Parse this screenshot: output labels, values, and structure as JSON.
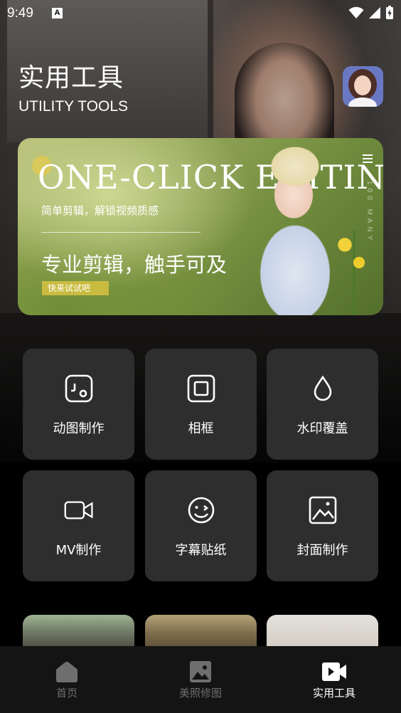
{
  "status_bar": {
    "time": "9:49",
    "notification_letter": "A"
  },
  "header": {
    "title": "实用工具",
    "subtitle": "UTILITY TOOLS"
  },
  "banner": {
    "headline": "ONE-CLICK EDITING",
    "subtitle": "简单剪辑，解锁视频质感",
    "slogan": "专业剪辑，触手可及",
    "cta": "快来试试吧",
    "vertical_text": "100 MANY"
  },
  "tools": [
    {
      "label": "动图制作",
      "icon": "gif-maker-icon"
    },
    {
      "label": "相框",
      "icon": "frame-icon"
    },
    {
      "label": "水印覆盖",
      "icon": "watermark-drop-icon"
    },
    {
      "label": "MV制作",
      "icon": "video-camera-icon"
    },
    {
      "label": "字幕贴纸",
      "icon": "wink-face-icon"
    },
    {
      "label": "封面制作",
      "icon": "image-icon"
    }
  ],
  "bottom_nav": {
    "items": [
      {
        "label": "首页",
        "icon": "home-icon",
        "active": false
      },
      {
        "label": "美照修图",
        "icon": "photo-icon",
        "active": false
      },
      {
        "label": "实用工具",
        "icon": "video-play-icon",
        "active": true
      }
    ]
  },
  "colors": {
    "card_bg": "#2e2e2e",
    "nav_bg": "#141414",
    "nav_inactive": "#6e6e6e",
    "cta_bg": "#c9bb40"
  }
}
